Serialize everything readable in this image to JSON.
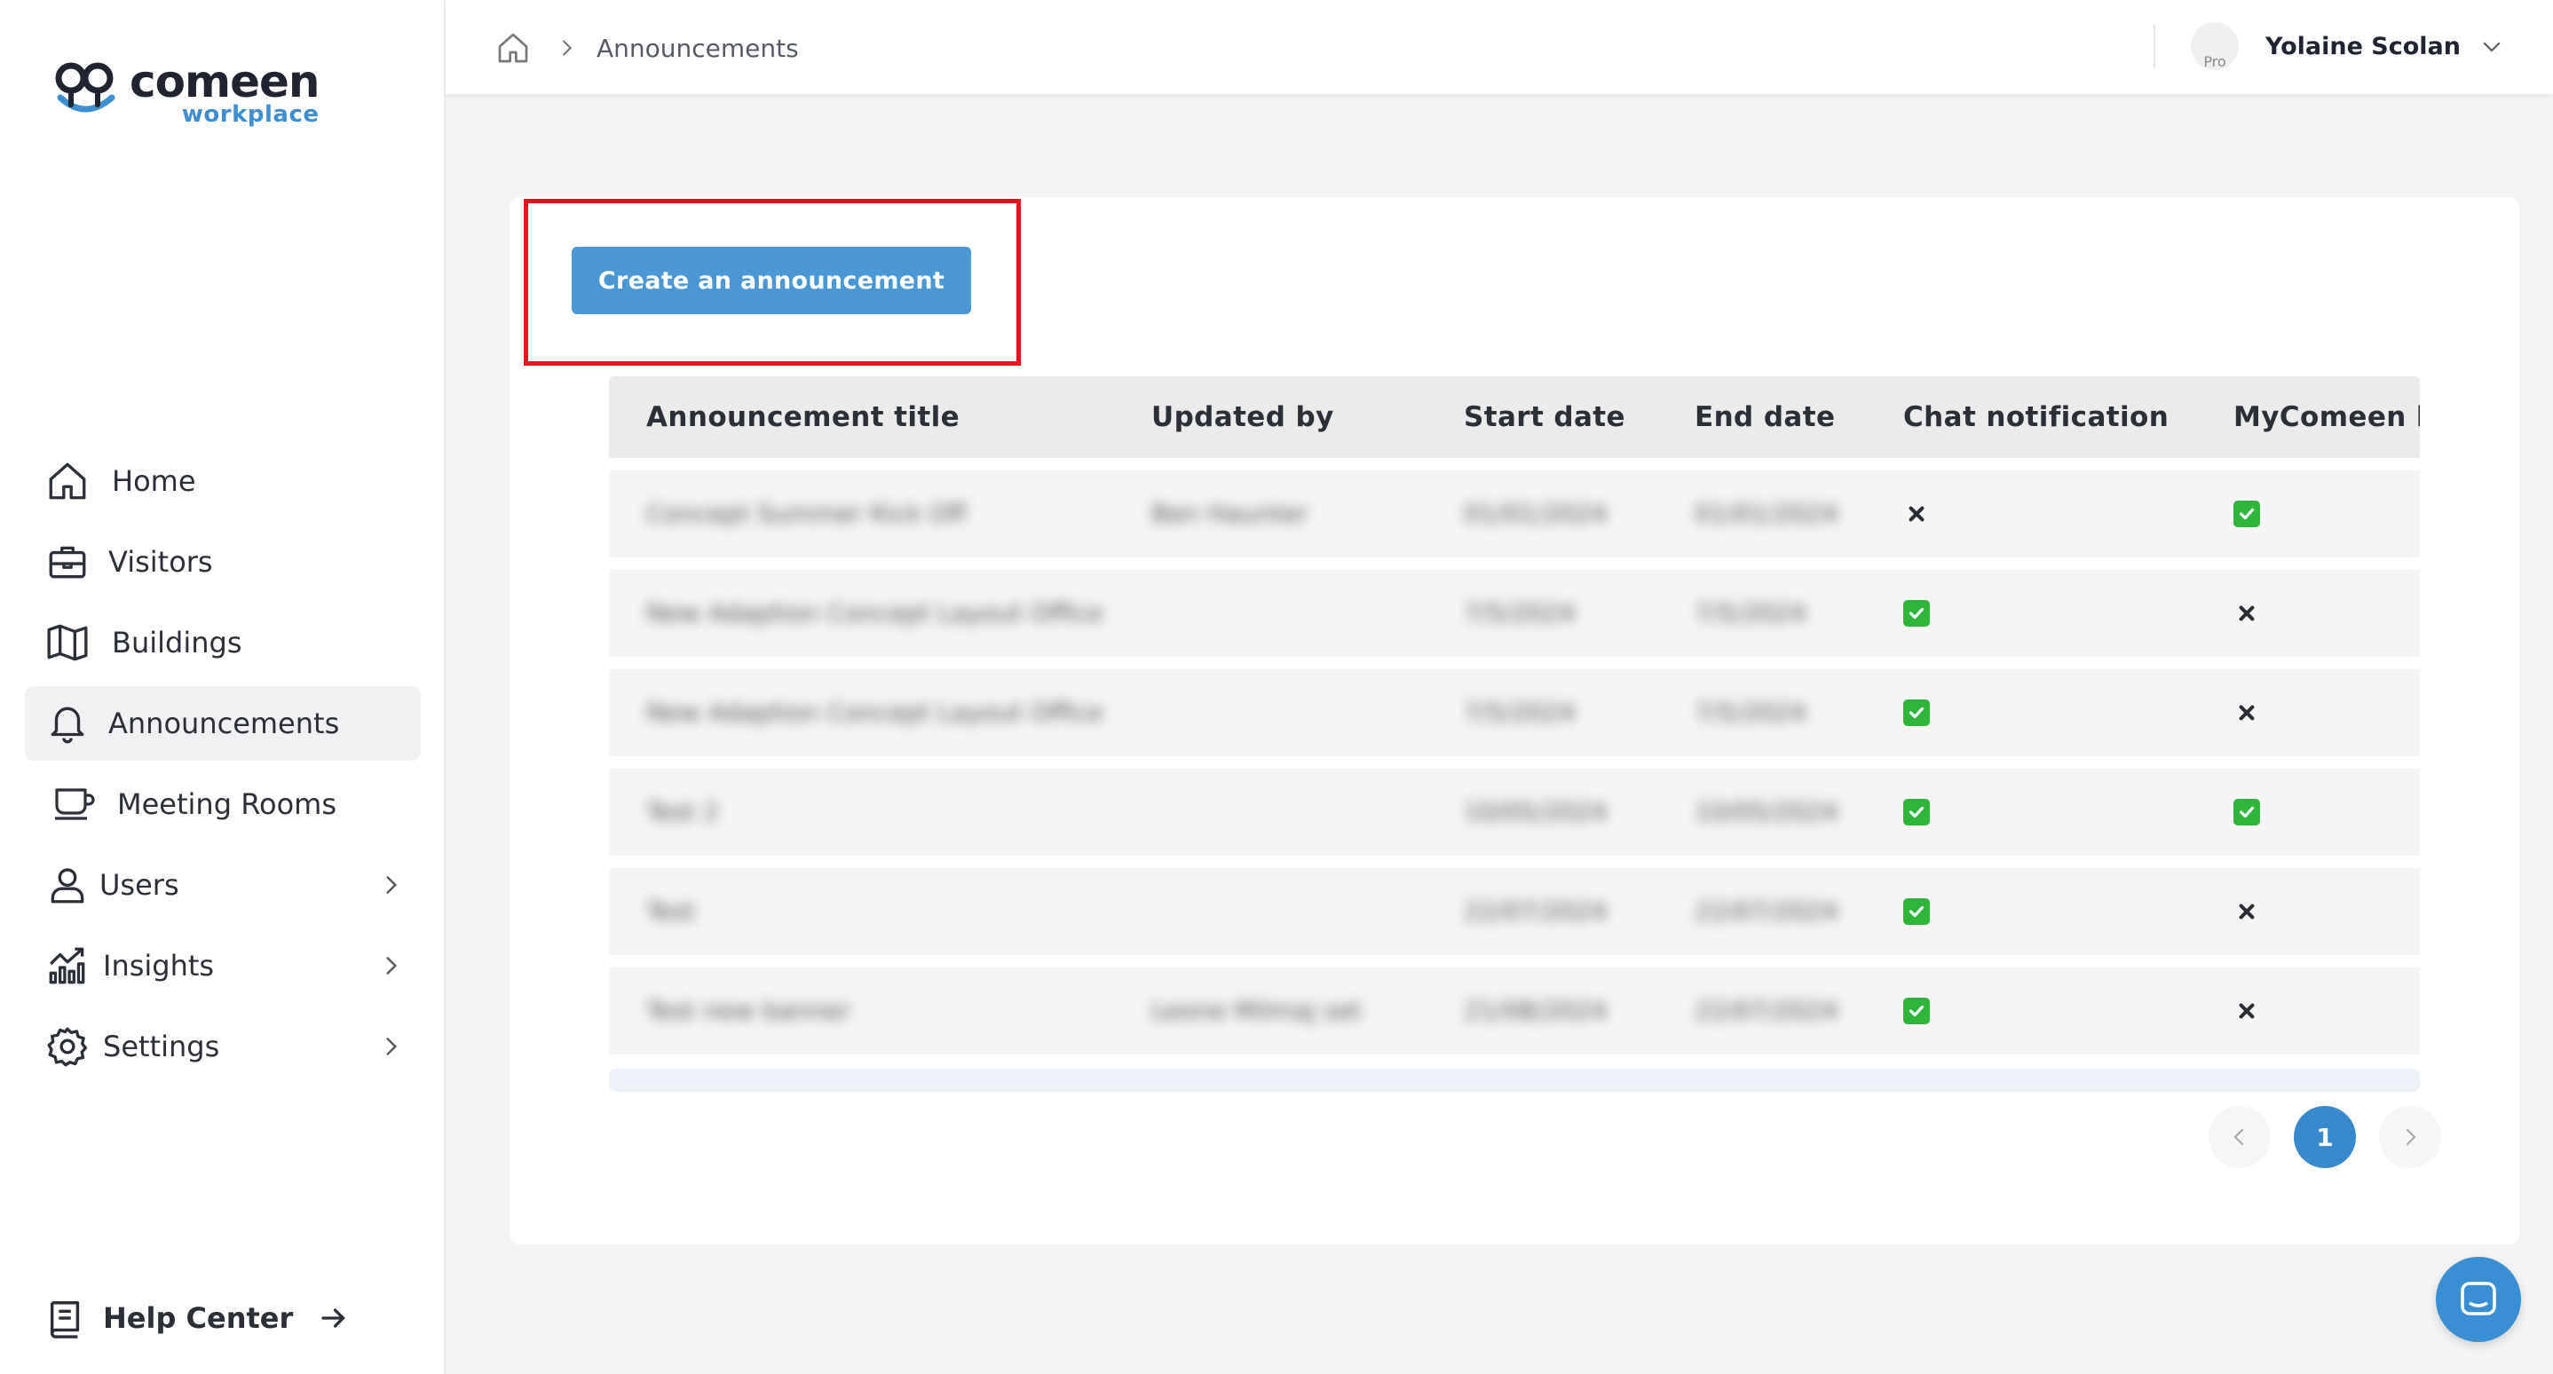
{
  "brand": {
    "name": "comeen",
    "sub": "workplace",
    "accent": "#3d8fd1"
  },
  "sidebar": {
    "items": [
      {
        "label": "Home",
        "icon": "home-icon",
        "active": false
      },
      {
        "label": "Visitors",
        "icon": "briefcase-icon",
        "active": false
      },
      {
        "label": "Buildings",
        "icon": "map-icon",
        "active": false
      },
      {
        "label": "Announcements",
        "icon": "bell-icon",
        "active": true
      },
      {
        "label": "Meeting Rooms",
        "icon": "cup-icon",
        "active": false
      },
      {
        "label": "Users",
        "icon": "user-icon",
        "active": false,
        "expandable": true
      },
      {
        "label": "Insights",
        "icon": "chart-icon",
        "active": false,
        "expandable": true
      },
      {
        "label": "Settings",
        "icon": "gear-icon",
        "active": false,
        "expandable": true
      }
    ],
    "help_label": "Help Center"
  },
  "header": {
    "breadcrumb": "Announcements",
    "user_name": "Yolaine Scolan",
    "avatar_alt": "Pro"
  },
  "main": {
    "create_label": "Create an announcement",
    "columns": [
      "Announcement title",
      "Updated by",
      "Start date",
      "End date",
      "Chat notification",
      "MyComeen b"
    ],
    "rows": [
      {
        "title": "Concept Summer Kick Off",
        "updated_by": "Ben Haunter",
        "start": "01/01/2024",
        "end": "01/01/2024",
        "chat": false,
        "mycomeen": true
      },
      {
        "title": "New Adaption Concept Layout Office",
        "updated_by": "",
        "start": "7/5/2024",
        "end": "7/5/2024",
        "chat": true,
        "mycomeen": false
      },
      {
        "title": "New Adaption Concept Layout Office",
        "updated_by": "",
        "start": "7/5/2024",
        "end": "7/5/2024",
        "chat": true,
        "mycomeen": false
      },
      {
        "title": "Test 2",
        "updated_by": "",
        "start": "10/05/2024",
        "end": "10/05/2024",
        "chat": true,
        "mycomeen": true
      },
      {
        "title": "Test",
        "updated_by": "",
        "start": "22/07/2024",
        "end": "22/07/2024",
        "chat": true,
        "mycomeen": false
      },
      {
        "title": "Test new banner",
        "updated_by": "Leone Milmaj set",
        "start": "21/08/2024",
        "end": "22/07/2024",
        "chat": true,
        "mycomeen": false
      }
    ],
    "page": "1"
  },
  "colors": {
    "button": "#4a97d3",
    "highlight": "#e8141b",
    "check": "#2fb53a",
    "pager": "#3889cc"
  }
}
